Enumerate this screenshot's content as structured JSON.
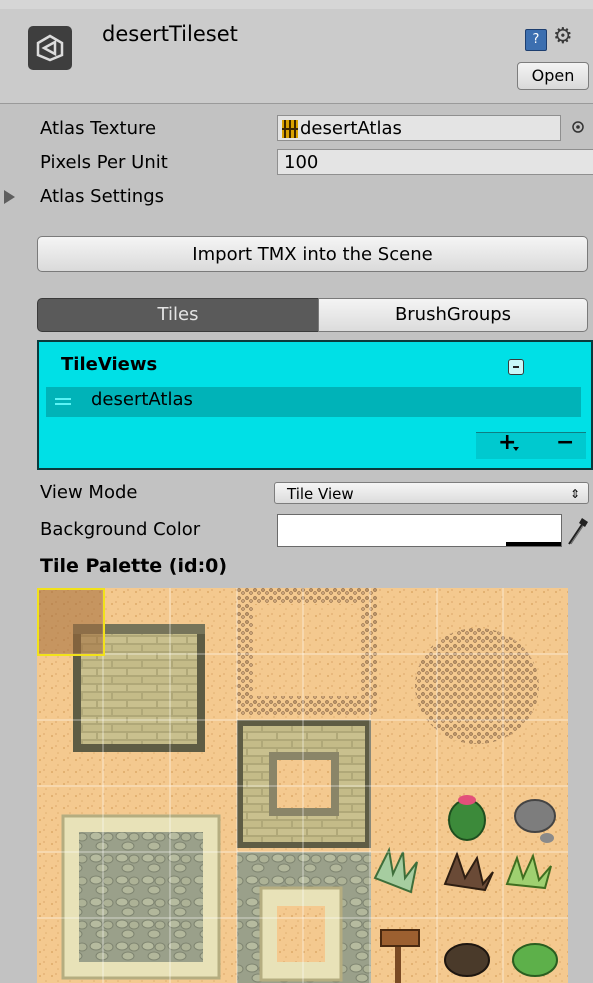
{
  "header": {
    "title": "desertTileset",
    "open_label": "Open",
    "help_icon_glyph": "?"
  },
  "fields": {
    "atlas_texture_label": "Atlas Texture",
    "atlas_texture_value": "desertAtlas",
    "pixels_per_unit_label": "Pixels Per Unit",
    "pixels_per_unit_value": "100",
    "atlas_settings_label": "Atlas Settings"
  },
  "import_button": "Import TMX into the Scene",
  "tabs": [
    {
      "label": "Tiles",
      "selected": true
    },
    {
      "label": "BrushGroups",
      "selected": false
    }
  ],
  "tileviews": {
    "title": "TileViews",
    "items": [
      "desertAtlas"
    ],
    "add_label": "+",
    "remove_label": "−",
    "background_color": "#00e0e6"
  },
  "view_mode": {
    "label": "View Mode",
    "value": "Tile View"
  },
  "background_color": {
    "label": "Background Color"
  },
  "palette": {
    "title": "Tile Palette (id:0)"
  },
  "icons": [
    "unity-logo-icon",
    "help-icon",
    "gear-icon",
    "object-picker-icon",
    "eyedropper-icon",
    "texture-icon"
  ]
}
